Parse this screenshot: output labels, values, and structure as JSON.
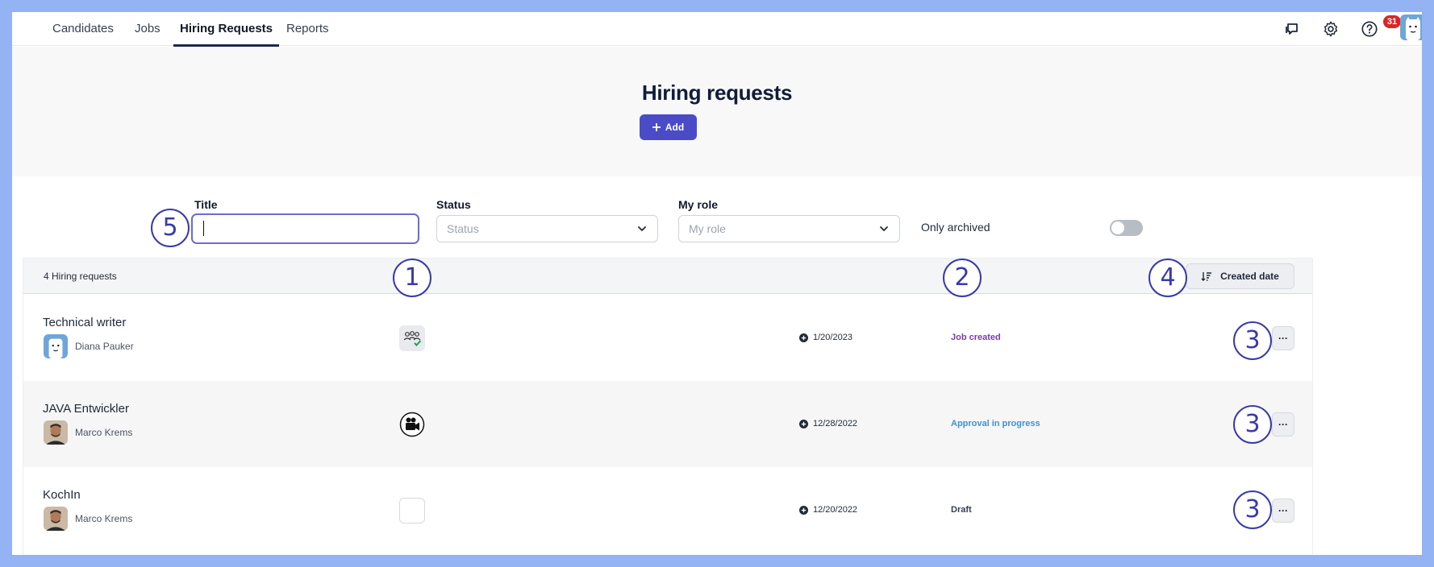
{
  "nav": {
    "tabs": [
      {
        "label": "Candidates"
      },
      {
        "label": "Jobs"
      },
      {
        "label": "Hiring Requests"
      },
      {
        "label": "Reports"
      }
    ],
    "active_tab": "Hiring Requests",
    "icons": [
      "chat-icon",
      "gear-icon",
      "help-icon",
      "avatar"
    ],
    "notification_count": "31"
  },
  "hero": {
    "title": "Hiring requests",
    "add_label": "Add"
  },
  "filters": {
    "title_label": "Title",
    "title_value": "",
    "status_label": "Status",
    "status_placeholder": "Status",
    "role_label": "My role",
    "role_placeholder": "My role",
    "archived_label": "Only archived",
    "archived_on": false
  },
  "list": {
    "count_text": "4 Hiring requests",
    "sort_label": "Created date",
    "rows": [
      {
        "title": "Technical writer",
        "person": "Diana Pauker",
        "icon": "team-check-icon",
        "date": "1/20/2023",
        "status": "Job created",
        "status_color": "#7c3aad"
      },
      {
        "title": "JAVA Entwickler",
        "person": "Marco Krems",
        "icon": "video-camera-icon",
        "date": "12/28/2022",
        "status": "Approval in progress",
        "status_color": "#3b93d4"
      },
      {
        "title": "KochIn",
        "person": "Marco Krems",
        "icon": "empty-icon",
        "date": "12/20/2022",
        "status": "Draft",
        "status_color": "#374151"
      }
    ]
  },
  "markers": [
    "1",
    "2",
    "3",
    "4",
    "5"
  ],
  "colors": {
    "accent": "#4b4bc8",
    "frame": "#93b3f4",
    "marker": "#3a3aa8",
    "badge": "#dc2626"
  }
}
